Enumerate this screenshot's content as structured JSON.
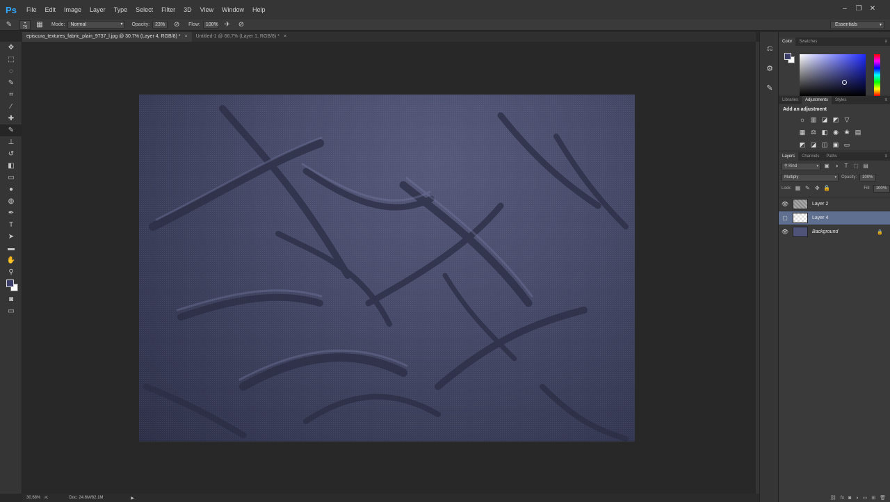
{
  "app": {
    "logo": "Ps"
  },
  "menu": [
    "File",
    "Edit",
    "Image",
    "Layer",
    "Type",
    "Select",
    "Filter",
    "3D",
    "View",
    "Window",
    "Help"
  ],
  "window_controls": [
    "–",
    "❐",
    "✕"
  ],
  "options": {
    "brush_size": "75",
    "mode_label": "Mode:",
    "mode_value": "Normal",
    "opacity_label": "Opacity:",
    "opacity_value": "23%",
    "flow_label": "Flow:",
    "flow_value": "100%",
    "workspace": "Essentials"
  },
  "tabs": [
    {
      "label": "episcura_textures_fabric_plain_9737_l.jpg @ 30.7% (Layer 4, RGB/8) *",
      "close": "×"
    },
    {
      "label": "Untitled-1 @ 66.7% (Layer 1, RGB/8) *",
      "close": "×"
    }
  ],
  "status": {
    "zoom": "30.68%",
    "doc": "Doc: 24.6M/82.1M"
  },
  "color_panel": {
    "tabs": [
      "Color",
      "Swatches"
    ],
    "fg": "#3b3f6a",
    "bg": "#ffffff"
  },
  "adjustments_panel": {
    "tabs": [
      "Libraries",
      "Adjustments",
      "Styles"
    ],
    "title": "Add an adjustment"
  },
  "layers_panel": {
    "tabs": [
      "Layers",
      "Channels",
      "Paths"
    ],
    "filter_label": "Kind",
    "blend_mode": "Multiply",
    "opacity_label": "Opacity:",
    "opacity_value": "100%",
    "lock_label": "Lock:",
    "fill_label": "Fill:",
    "fill_value": "100%",
    "layers": [
      {
        "name": "Layer 2",
        "visible": true,
        "selected": false
      },
      {
        "name": "Layer 4",
        "visible": false,
        "selected": true
      },
      {
        "name": "Background",
        "visible": true,
        "selected": false,
        "locked": true
      }
    ]
  }
}
